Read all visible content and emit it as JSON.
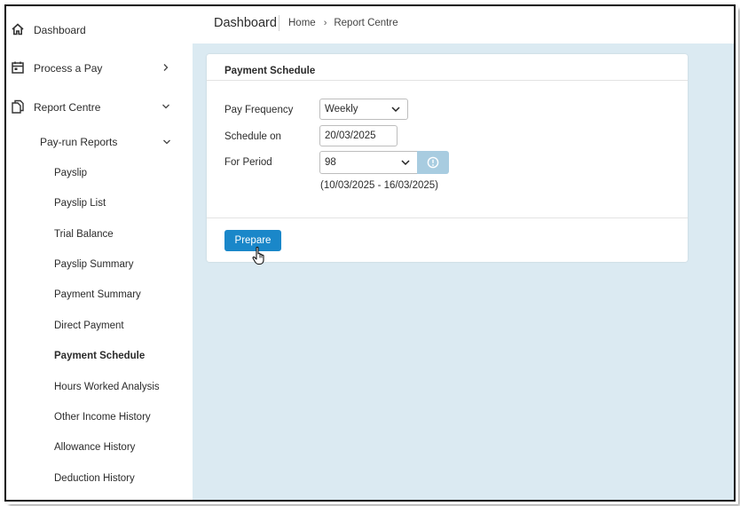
{
  "sidebar": {
    "top_items": [
      {
        "label": "Dashboard",
        "icon": "home-icon"
      },
      {
        "label": "Process a Pay",
        "icon": "calendar-icon",
        "chevron": "chevron-right-icon"
      },
      {
        "label": "Report Centre",
        "icon": "copy-documents-icon",
        "chevron": "chevron-down-icon"
      }
    ],
    "submenu": {
      "label": "Pay-run Reports",
      "chevron": "chevron-down-icon"
    },
    "report_items": [
      "Payslip",
      "Payslip List",
      "Trial Balance",
      "Payslip Summary",
      "Payment Summary",
      "Direct Payment",
      "Payment Schedule",
      "Hours Worked Analysis",
      "Other Income History",
      "Allowance History",
      "Deduction History"
    ],
    "active_item": "Payment Schedule"
  },
  "header": {
    "title": "Dashboard",
    "breadcrumb": {
      "home": "Home",
      "separator": "›",
      "current": "Report Centre"
    }
  },
  "card": {
    "title": "Payment Schedule",
    "pay_frequency": {
      "label": "Pay Frequency",
      "value": "Weekly"
    },
    "schedule_on": {
      "label": "Schedule on",
      "value": "20/03/2025"
    },
    "for_period": {
      "label": "For Period",
      "value": "98",
      "range": "(10/03/2025 - 16/03/2025)"
    },
    "prepare_label": "Prepare"
  },
  "colors": {
    "main_bg": "#dbeaf2",
    "primary_button": "#1a87c9",
    "info_button": "#a8cce0"
  }
}
